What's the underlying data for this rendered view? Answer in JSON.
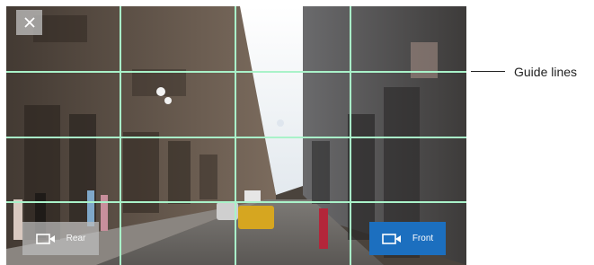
{
  "camera_view": {
    "close_icon": "close-icon",
    "rear_button": {
      "label": "Rear",
      "icon": "video-camera-icon"
    },
    "front_button": {
      "label": "Front",
      "icon": "video-camera-icon",
      "state": "selected"
    },
    "grid": {
      "rows": 4,
      "columns": 4
    }
  },
  "annotation": {
    "guide_lines_label": "Guide lines"
  },
  "colors": {
    "grid_line": "#a9f2c9",
    "front_button_bg": "#1c6fbf",
    "rear_button_bg": "#bebebe"
  }
}
